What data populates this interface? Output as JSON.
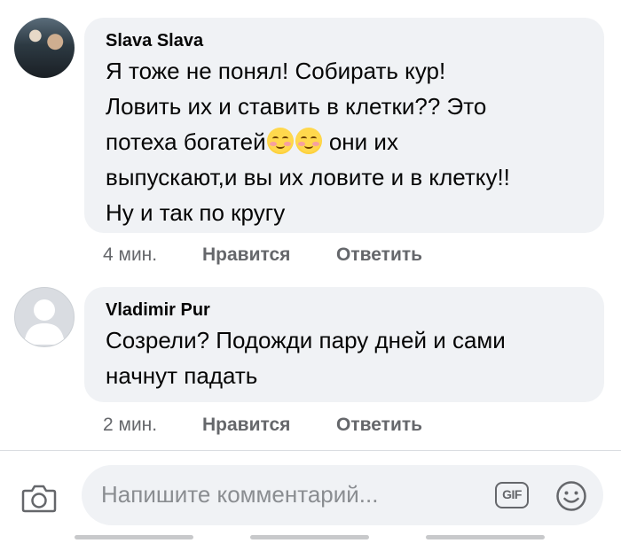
{
  "comments": [
    {
      "author": "Slava Slava",
      "text_before_emoji": "Я тоже не понял! Собирать кур!\nЛовить их и ставить в клетки?? Это\nпотеха богатей",
      "emoji_name": "smiling-face-with-smiling-eyes-emoji",
      "text_after_emoji": " они их\nвыпускают,и вы их ловите и в клетку!!\nНу и так по кругу",
      "time": "4 мин.",
      "like_label": "Нравится",
      "reply_label": "Ответить"
    },
    {
      "author": "Vladimir Pur",
      "text": "Созрели? Подожди пару дней и сами\nначнут падать",
      "time": "2 мин.",
      "like_label": "Нравится",
      "reply_label": "Ответить"
    }
  ],
  "composer": {
    "placeholder": "Напишите комментарий...",
    "gif_label": "GIF",
    "camera_icon": "camera-icon",
    "emoji_icon": "smiley-icon"
  },
  "colors": {
    "bubble": "#f0f2f5",
    "meta": "#65676b",
    "text": "#050505"
  }
}
